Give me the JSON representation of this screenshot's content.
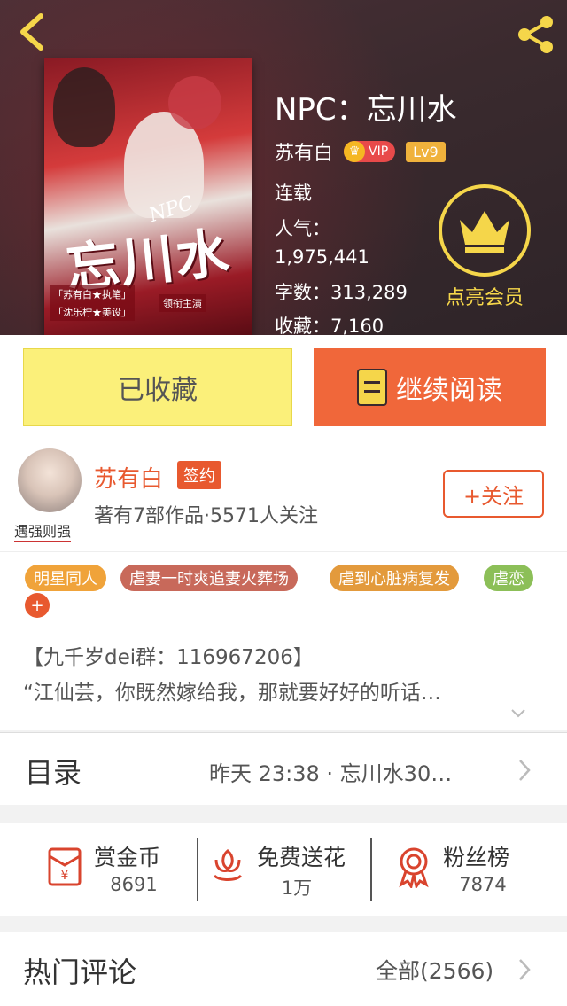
{
  "header": {
    "book_title": "NPC：忘川水",
    "author": "苏有白",
    "vip_label": "VIP",
    "level_label": "Lv9",
    "status": "连载",
    "popularity_label": "人气：",
    "popularity_value": "1,975,441",
    "word_count": "字数：313,289",
    "favorites": "收藏：7,160",
    "member_label": "点亮会员",
    "cover": {
      "title": "忘川水",
      "subtitle": "NPC",
      "credit_1": "「苏有白★执笔」",
      "credit_2": "「沈乐柠★美设」",
      "credit_3": "领衔主演"
    }
  },
  "actions": {
    "collected_label": "已收藏",
    "read_label": "继续阅读"
  },
  "author_card": {
    "name": "苏有白",
    "signed_label": "签约",
    "avatar_tag": "遇强则强",
    "stats": "著有7部作品·5571人关注",
    "follow_label": "+关注"
  },
  "tags": [
    {
      "label": "明星同人",
      "color": "#f0a33a"
    },
    {
      "label": "虐妻一时爽追妻火葬场",
      "color": "#c8695a"
    },
    {
      "label": "虐到心脏病复发",
      "color": "#e39a3c"
    },
    {
      "label": "虐恋",
      "color": "#8cbf58"
    }
  ],
  "tag_add_label": "+",
  "description": {
    "line1": "【九千岁dei群：116967206】",
    "line2": "“江仙芸，你既然嫁给我，那就要好好的听话…"
  },
  "catalog": {
    "title": "目录",
    "latest": "昨天 23:38 · 忘川水30…"
  },
  "stats": [
    {
      "label": "赏金币",
      "value": "8691",
      "icon": "red-packet-icon"
    },
    {
      "label": "免费送花",
      "value": "1万",
      "icon": "flower-icon"
    },
    {
      "label": "粉丝榜",
      "value": "7874",
      "icon": "medal-icon"
    }
  ],
  "comments": {
    "title": "热门评论",
    "all_label": "全部(2566)"
  },
  "colors": {
    "accent": "#e8592f",
    "gold": "#f5d64a",
    "collected_bg": "#fbf07a",
    "read_bg": "#f0673a"
  }
}
